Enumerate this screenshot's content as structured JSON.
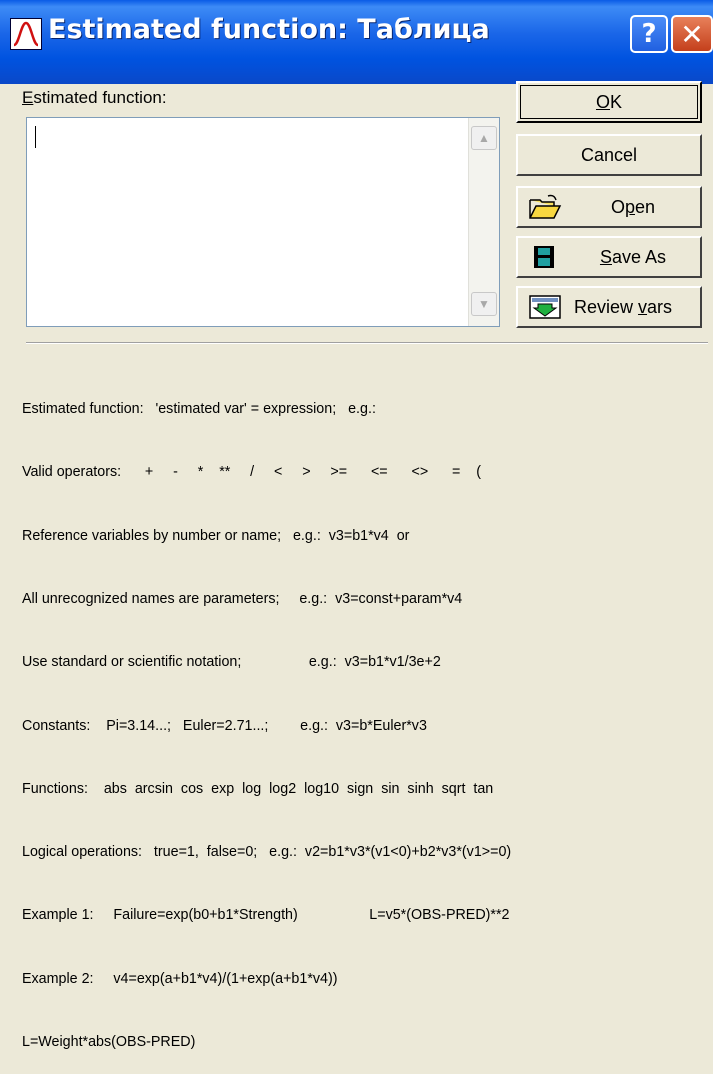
{
  "window": {
    "title": "Estimated function: Таблица",
    "help_glyph": "?",
    "close_glyph": "✕"
  },
  "form": {
    "function_label_accel": "E",
    "function_label_rest": "stimated function:",
    "function_value": ""
  },
  "buttons": {
    "ok_accel": "O",
    "ok_rest": "K",
    "cancel": "Cancel",
    "open_pre": "O",
    "open_accel": "p",
    "open_post": "en",
    "save_accel": "S",
    "save_rest": "ave As",
    "review_pre": "Review ",
    "review_accel": "v",
    "review_post": "ars"
  },
  "help_lines": [
    "Estimated function:   'estimated var' = expression;   e.g.:",
    "Valid operators:      +     -     *    **     /     <     >     >=      <=      <>      =    (",
    "Reference variables by number or name;   e.g.:  v3=b1*v4  or",
    "All unrecognized names are parameters;     e.g.:  v3=const+param*v4",
    "Use standard or scientific notation;                 e.g.:  v3=b1*v1/3e+2",
    "Constants:    Pi=3.14...;   Euler=2.71...;        e.g.:  v3=b*Euler*v3",
    "Functions:    abs  arcsin  cos  exp  log  log2  log10  sign  sin  sinh  sqrt  tan",
    "Logical operations:   true=1,  false=0;   e.g.:  v2=b1*v3*(v1<0)+b2*v3*(v1>=0)",
    "Example 1:     Failure=exp(b0+b1*Strength)                  L=v5*(OBS-PRED)**2",
    "Example 2:     v4=exp(a+b1*v4)/(1+exp(a+b1*v4))",
    "L=Weight*abs(OBS-PRED)"
  ],
  "colors": {
    "titlebar": "#0053e0",
    "dialog_bg": "#ece9d8",
    "close_button": "#c4401c"
  }
}
